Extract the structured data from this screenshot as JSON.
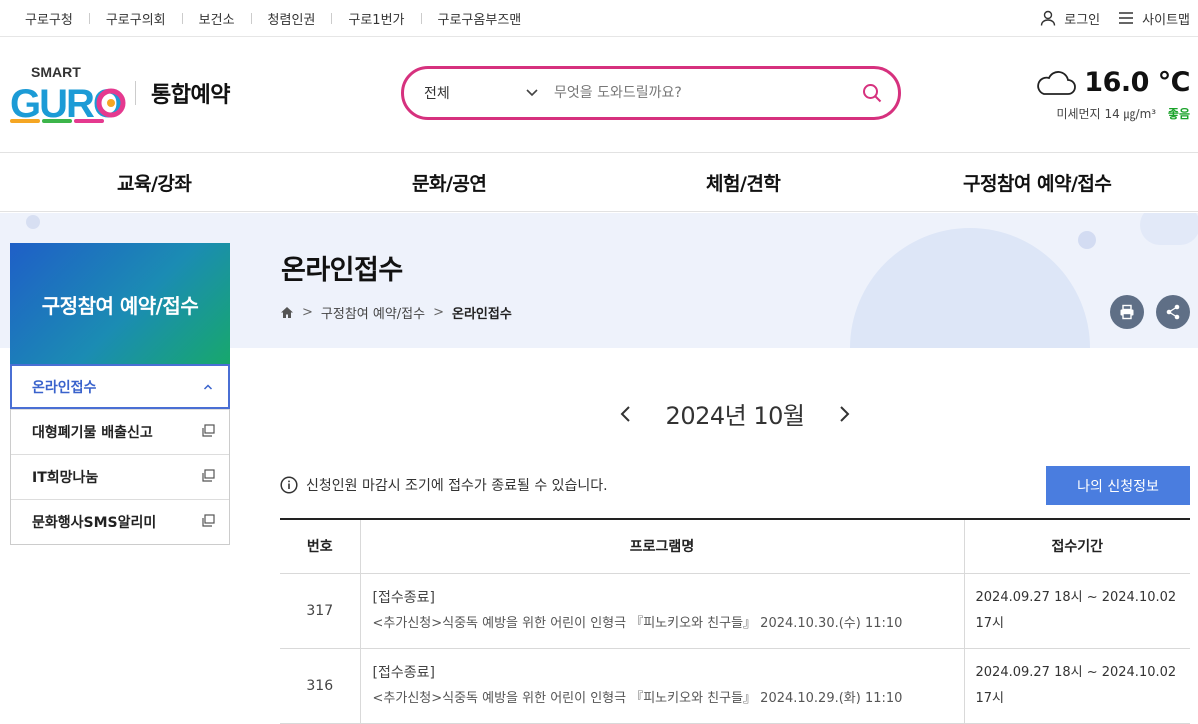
{
  "top_links": [
    "구로구청",
    "구로구의회",
    "보건소",
    "청렴인권",
    "구로1번가",
    "구로구옴부즈맨"
  ],
  "top_right": {
    "login": "로그인",
    "sitemap": "사이트맵"
  },
  "logo": {
    "smart": "SMART",
    "guro": "GURO",
    "title": "통합예약"
  },
  "search": {
    "scope": "전체",
    "placeholder": "무엇을 도와드릴까요?"
  },
  "weather": {
    "temperature": "16.0 ℃",
    "dust_label": "미세먼지",
    "dust_value": "14 ㎍/m³",
    "dust_grade": "좋음"
  },
  "gnb": [
    "교육/강좌",
    "문화/공연",
    "체험/견학",
    "구정참여 예약/접수"
  ],
  "page": {
    "title": "온라인접수",
    "breadcrumb": [
      "구정참여 예약/접수",
      "온라인접수"
    ]
  },
  "sidebar": {
    "title": "구정참여 예약/접수",
    "items": [
      {
        "label": "온라인접수"
      },
      {
        "label": "대형폐기물 배출신고"
      },
      {
        "label": "IT희망나눔"
      },
      {
        "label": "문화행사SMS알리미"
      }
    ]
  },
  "calendar": {
    "month": "2024년 10월"
  },
  "notice": {
    "text": "신청인원 마감시 조기에 접수가 종료될 수 있습니다.",
    "my_button": "나의 신청정보"
  },
  "colors": {
    "search_border": "#d6317e",
    "accent": "#4a7ddf",
    "good": "#1aa32a"
  },
  "table": {
    "headers": [
      "번호",
      "프로그램명",
      "접수기간"
    ],
    "rows": [
      {
        "no": "317",
        "status": "[접수종료]",
        "name": "<추가신청>식중독 예방을 위한 어린이 인형극 『피노키오와 친구들』 2024.10.30.(수) 11:10",
        "period": "2024.09.27 18시 ~ 2024.10.02 17시"
      },
      {
        "no": "316",
        "status": "[접수종료]",
        "name": "<추가신청>식중독 예방을 위한 어린이 인형극 『피노키오와 친구들』 2024.10.29.(화) 11:10",
        "period": "2024.09.27 18시 ~ 2024.10.02 17시"
      }
    ]
  }
}
